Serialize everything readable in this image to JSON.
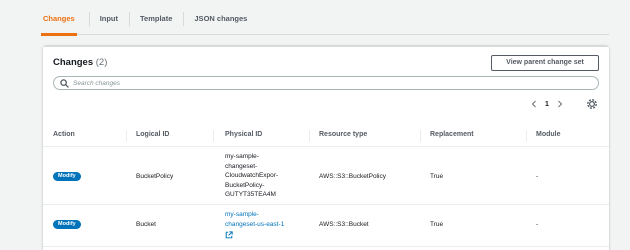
{
  "tabs": [
    {
      "label": "Changes",
      "active": true
    },
    {
      "label": "Input",
      "active": false
    },
    {
      "label": "Template",
      "active": false
    },
    {
      "label": "JSON changes",
      "active": false
    }
  ],
  "changes": {
    "title": "Changes",
    "count": "(2)",
    "view_parent_label": "View parent change set",
    "search_placeholder": "Search changes",
    "pagination": {
      "current_page": "1"
    },
    "columns": [
      "Action",
      "Logical ID",
      "Physical ID",
      "Resource type",
      "Replacement",
      "Module"
    ],
    "rows": [
      {
        "action": "Modify",
        "logical_id": "BucketPolicy",
        "physical_id_lines": [
          "my-sample-",
          "changeset-",
          "CloudwatchExpor-",
          "BucketPolicy-",
          "GUTYT35TEA4M"
        ],
        "resource_type": "AWS::S3::BucketPolicy",
        "replacement": "True",
        "module": "-"
      },
      {
        "action": "Modify",
        "logical_id": "Bucket",
        "physical_id_lines": [
          "my-sample-",
          "changeset-us-east-1"
        ],
        "physical_id_external_link": true,
        "resource_type": "AWS::S3::Bucket",
        "replacement": "True",
        "module": "-"
      }
    ]
  },
  "colors": {
    "accent": "#ec7211",
    "link": "#0073bb",
    "badge": "#0073bb"
  },
  "icons": {
    "search": "search-icon",
    "prev": "chevron-left-icon",
    "next": "chevron-right-icon",
    "settings": "gear-icon",
    "external": "external-link-icon"
  }
}
